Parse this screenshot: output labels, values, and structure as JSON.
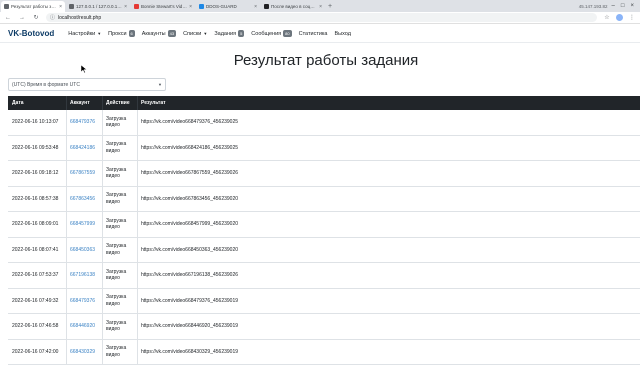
{
  "browser": {
    "tabs": [
      {
        "label": "Результат работы задания",
        "active": true,
        "icon": "page-icon"
      },
      {
        "label": "127.0.0.1 / 127.0.0.1 / vk_",
        "active": false,
        "icon": "db-icon"
      },
      {
        "label": "Bonnie Stewart's Videos",
        "active": false,
        "icon": "video-icon"
      },
      {
        "label": "DDOS-GUARD",
        "active": false,
        "icon": "shield-icon"
      },
      {
        "label": "После видео в социальной",
        "active": false,
        "icon": "x-icon"
      }
    ],
    "new_tab": "+",
    "ip": "45.147.193.82",
    "url": "localhost/result.php",
    "window_controls": [
      "–",
      "□",
      "×"
    ]
  },
  "navbar": {
    "brand": "VK-Botovod",
    "items": [
      {
        "label": "Настройки",
        "dropdown": true
      },
      {
        "label": "Прокси",
        "badge": "6"
      },
      {
        "label": "Аккаунты",
        "badge": "43"
      },
      {
        "label": "Списки",
        "dropdown": true
      },
      {
        "label": "Задания",
        "badge": "5"
      },
      {
        "label": "Сообщения",
        "badge": "80"
      },
      {
        "label": "Статистика"
      },
      {
        "label": "Выход"
      }
    ]
  },
  "page": {
    "title": "Результат работы задания",
    "timezone_select": "(UTC) Время в формате UTC"
  },
  "table": {
    "headers": [
      "Дата",
      "Аккаунт",
      "Действие",
      "Результат"
    ],
    "rows": [
      {
        "date": "2022-06-16 10:13:07",
        "account": "668479376",
        "action": "Загрузка видео",
        "result": "https://vk.com/video668479376_456239025"
      },
      {
        "date": "2022-06-16 09:53:48",
        "account": "668424186",
        "action": "Загрузка видео",
        "result": "https://vk.com/video668424186_456239025"
      },
      {
        "date": "2022-06-16 09:18:12",
        "account": "667867559",
        "action": "Загрузка видео",
        "result": "https://vk.com/video667867559_456239026"
      },
      {
        "date": "2022-06-16 08:57:38",
        "account": "667863456",
        "action": "Загрузка видео",
        "result": "https://vk.com/video667863456_456239020"
      },
      {
        "date": "2022-06-16 08:09:01",
        "account": "668457999",
        "action": "Загрузка видео",
        "result": "https://vk.com/video668457999_456239020"
      },
      {
        "date": "2022-06-16 08:07:41",
        "account": "668450363",
        "action": "Загрузка видео",
        "result": "https://vk.com/video668450363_456239020"
      },
      {
        "date": "2022-06-16 07:53:37",
        "account": "667196138",
        "action": "Загрузка видео",
        "result": "https://vk.com/video667196138_456239026"
      },
      {
        "date": "2022-06-16 07:49:32",
        "account": "668479376",
        "action": "Загрузка видео",
        "result": "https://vk.com/video668479376_456239019"
      },
      {
        "date": "2022-06-16 07:46:58",
        "account": "668446920",
        "action": "Загрузка видео",
        "result": "https://vk.com/video668446920_456239019"
      },
      {
        "date": "2022-06-16 07:42:00",
        "account": "668430329",
        "action": "Загрузка видео",
        "result": "https://vk.com/video668430329_456239019"
      }
    ]
  },
  "colors": {
    "brand": "#0d3b66",
    "table_header_bg": "#212529",
    "link": "#3b82c4"
  }
}
